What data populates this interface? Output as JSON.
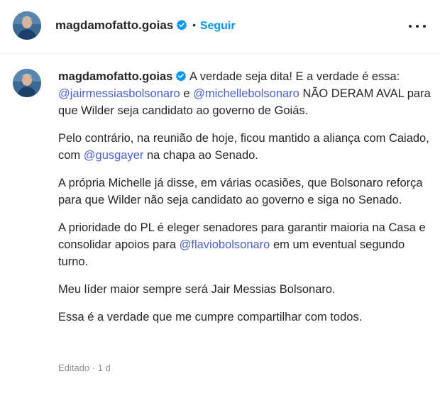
{
  "header": {
    "username": "magdamofatto.goias",
    "separator": "•",
    "follow_label": "Seguir"
  },
  "post": {
    "author": "magdamofatto.goias",
    "p1": {
      "t1": "A verdade seja dita! E a verdade é essa:",
      "m1": "@jairmessiasbolsonaro",
      "t2": " e ",
      "m2": "@michellebolsonaro",
      "t3": " NÃO DERAM AVAL para que Wilder seja candidato ao governo de Goiás."
    },
    "p2": {
      "t1": "Pelo contrário, na reunião de hoje, ficou mantido a aliança com Caiado, com ",
      "m1": "@gusgayer",
      "t2": " na chapa ao Senado."
    },
    "p3": "A própria Michelle já disse, em várias ocasiões, que Bolsonaro reforça para que Wilder não seja candidato ao governo e siga no Senado.",
    "p4": {
      "t1": "A prioridade do PL é eleger senadores para garantir maioria na Casa e consolidar apoios para ",
      "m1": "@flaviobolsonaro",
      "t2": " em um eventual segundo turno."
    },
    "p5": "Meu líder maior sempre será Jair Messias Bolsonaro.",
    "p6": "Essa é a verdade que me cumpre compartilhar com todos.",
    "meta": "Editado · 1 d"
  },
  "colors": {
    "link": "#4a5ed6",
    "follow": "#0095f6",
    "verified": "#0095f6",
    "muted": "#8e8e8e"
  },
  "icons": {
    "verified": "verified-badge-icon",
    "more": "more-options-icon"
  }
}
